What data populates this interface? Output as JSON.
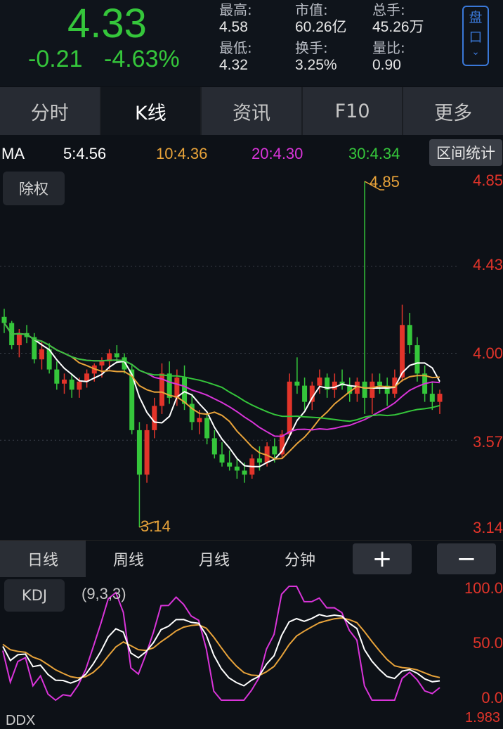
{
  "quote": {
    "price": "4.33",
    "change": "-0.21",
    "change_pct": "-4.63%",
    "colors": {
      "down": "#35c63b",
      "up": "#e2342a"
    }
  },
  "stats": [
    {
      "label": "最高:",
      "value": "4.58"
    },
    {
      "label": "市值:",
      "value": "60.26亿"
    },
    {
      "label": "总手:",
      "value": "45.26万"
    },
    {
      "label": "最低:",
      "value": "4.32"
    },
    {
      "label": "换手:",
      "value": "3.25%"
    },
    {
      "label": "量比:",
      "value": "0.90"
    }
  ],
  "pankou_button": {
    "line1": "盘",
    "line2": "口",
    "chevron": "⌄",
    "icon": "chevron-down-icon"
  },
  "tabs": [
    "分时",
    "K线",
    "资讯",
    "F10",
    "更多"
  ],
  "active_tab": "K线",
  "ma_row": {
    "label": "MA",
    "ma5": "5:4.56",
    "ma10": "10:4.36",
    "ma20": "20:4.30",
    "ma30": "30:4.34",
    "colors": {
      "ma5": "#ffffff",
      "ma10": "#e8a33a",
      "ma20": "#d934d9",
      "ma30": "#35c63b"
    }
  },
  "range_stat_button": "区间统计",
  "chuquan_button": "除权",
  "y_axis_labels": [
    "4.85",
    "4.43",
    "4.00",
    "3.57",
    "3.14"
  ],
  "annotations": {
    "high": "4.85",
    "low": "3.14"
  },
  "period_tabs": [
    "日线",
    "周线",
    "月线",
    "分钟"
  ],
  "active_period": "日线",
  "zoom_in": "+",
  "zoom_out": "−",
  "kdj": {
    "label": "KDJ",
    "params": "(9,3,3)",
    "axis": [
      "100.0",
      "50.0",
      "0.0"
    ]
  },
  "bottom_indicator": {
    "label": "DDX",
    "value": "1.983"
  },
  "chart_data": {
    "type": "candlestick",
    "ylim": [
      3.14,
      4.85
    ],
    "candles": [
      [
        4.18,
        4.22,
        4.1,
        4.15
      ],
      [
        4.15,
        4.16,
        4.02,
        4.04
      ],
      [
        4.04,
        4.12,
        3.98,
        4.1
      ],
      [
        4.1,
        4.14,
        4.05,
        4.08
      ],
      [
        4.08,
        4.1,
        3.95,
        3.97
      ],
      [
        3.97,
        4.06,
        3.92,
        4.02
      ],
      [
        4.02,
        4.05,
        3.9,
        3.92
      ],
      [
        3.92,
        3.96,
        3.82,
        3.85
      ],
      [
        3.85,
        3.9,
        3.8,
        3.87
      ],
      [
        3.87,
        3.9,
        3.78,
        3.82
      ],
      [
        3.82,
        3.88,
        3.78,
        3.86
      ],
      [
        3.86,
        3.92,
        3.83,
        3.9
      ],
      [
        3.9,
        3.95,
        3.86,
        3.94
      ],
      [
        3.94,
        3.98,
        3.88,
        3.96
      ],
      [
        3.96,
        4.02,
        3.92,
        4.0
      ],
      [
        4.0,
        4.04,
        3.95,
        3.98
      ],
      [
        3.98,
        4.0,
        3.9,
        3.92
      ],
      [
        3.92,
        3.94,
        3.6,
        3.62
      ],
      [
        3.62,
        3.66,
        3.14,
        3.4
      ],
      [
        3.4,
        3.65,
        3.36,
        3.62
      ],
      [
        3.62,
        3.78,
        3.58,
        3.74
      ],
      [
        3.74,
        3.95,
        3.7,
        3.9
      ],
      [
        3.9,
        3.96,
        3.75,
        3.78
      ],
      [
        3.78,
        3.92,
        3.74,
        3.88
      ],
      [
        3.88,
        3.94,
        3.72,
        3.75
      ],
      [
        3.75,
        3.8,
        3.62,
        3.66
      ],
      [
        3.66,
        3.72,
        3.6,
        3.68
      ],
      [
        3.68,
        3.7,
        3.55,
        3.58
      ],
      [
        3.58,
        3.62,
        3.48,
        3.5
      ],
      [
        3.5,
        3.56,
        3.44,
        3.46
      ],
      [
        3.46,
        3.52,
        3.42,
        3.44
      ],
      [
        3.44,
        3.48,
        3.38,
        3.42
      ],
      [
        3.42,
        3.46,
        3.36,
        3.4
      ],
      [
        3.4,
        3.5,
        3.38,
        3.48
      ],
      [
        3.48,
        3.54,
        3.42,
        3.46
      ],
      [
        3.46,
        3.56,
        3.44,
        3.54
      ],
      [
        3.54,
        3.58,
        3.46,
        3.5
      ],
      [
        3.5,
        3.62,
        3.48,
        3.6
      ],
      [
        3.6,
        3.9,
        3.58,
        3.86
      ],
      [
        3.86,
        3.98,
        3.8,
        3.84
      ],
      [
        3.84,
        3.88,
        3.72,
        3.76
      ],
      [
        3.76,
        3.86,
        3.72,
        3.84
      ],
      [
        3.84,
        3.92,
        3.8,
        3.88
      ],
      [
        3.88,
        3.9,
        3.78,
        3.82
      ],
      [
        3.82,
        3.9,
        3.78,
        3.86
      ],
      [
        3.86,
        3.92,
        3.82,
        3.84
      ],
      [
        3.84,
        3.88,
        3.76,
        3.8
      ],
      [
        3.8,
        3.88,
        3.76,
        3.86
      ],
      [
        3.86,
        4.85,
        3.7,
        3.78
      ],
      [
        3.78,
        3.9,
        3.7,
        3.86
      ],
      [
        3.86,
        3.9,
        3.8,
        3.84
      ],
      [
        3.84,
        3.88,
        3.74,
        3.8
      ],
      [
        3.8,
        3.92,
        3.78,
        3.88
      ],
      [
        3.88,
        4.24,
        3.86,
        4.14
      ],
      [
        4.14,
        4.2,
        4.0,
        4.04
      ],
      [
        4.04,
        4.08,
        3.86,
        3.9
      ],
      [
        3.9,
        3.94,
        3.76,
        3.8
      ],
      [
        3.8,
        3.86,
        3.72,
        3.76
      ],
      [
        3.76,
        3.82,
        3.7,
        3.8
      ]
    ]
  }
}
